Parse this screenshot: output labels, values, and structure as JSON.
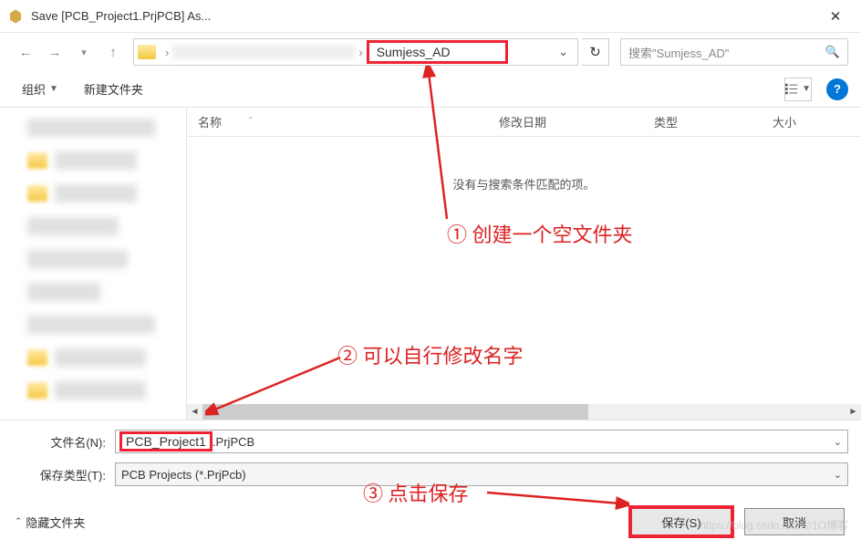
{
  "window": {
    "title": "Save [PCB_Project1.PrjPCB] As..."
  },
  "navbar": {
    "current_folder": "Sumjess_AD",
    "search_placeholder": "搜索\"Sumjess_AD\""
  },
  "toolbar": {
    "organize": "组织",
    "new_folder": "新建文件夹"
  },
  "columns": {
    "name": "名称",
    "date": "修改日期",
    "type": "类型",
    "size": "大小"
  },
  "main": {
    "empty_message": "没有与搜索条件匹配的项。"
  },
  "form": {
    "filename_label": "文件名(N):",
    "filename_value_highlighted": "PCB_Project1",
    "filename_value_rest": ".PrjPCB",
    "filetype_label": "保存类型(T):",
    "filetype_value": "PCB Projects (*.PrjPcb)"
  },
  "bottom": {
    "hide_folders": "隐藏文件夹",
    "save": "保存(S)",
    "cancel": "取消"
  },
  "annotations": {
    "ann1": "①  创建一个空文件夹",
    "ann2": "②  可以自行修改名字",
    "ann3": "③  点击保存"
  },
  "watermark": "https://blog.csdn.net/ ©1O博客"
}
